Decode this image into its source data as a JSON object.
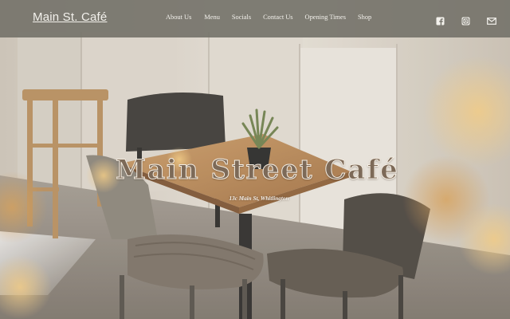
{
  "header": {
    "brand": "Main St. Café",
    "nav": {
      "about": "About Us",
      "menu": "Menu",
      "socials": "Socials",
      "contact": "Contact Us",
      "opening": "Opening Times",
      "shop": "Shop"
    },
    "icons": [
      "facebook-icon",
      "instagram-icon",
      "mail-icon"
    ]
  },
  "hero": {
    "title": "Main Street Café",
    "address": "13c Main St, Whitlington"
  },
  "colors": {
    "header_bg": "#76746c",
    "header_text": "#f3f1ec",
    "title_fill": "#7d6a58",
    "title_outline": "#f4ede2"
  }
}
